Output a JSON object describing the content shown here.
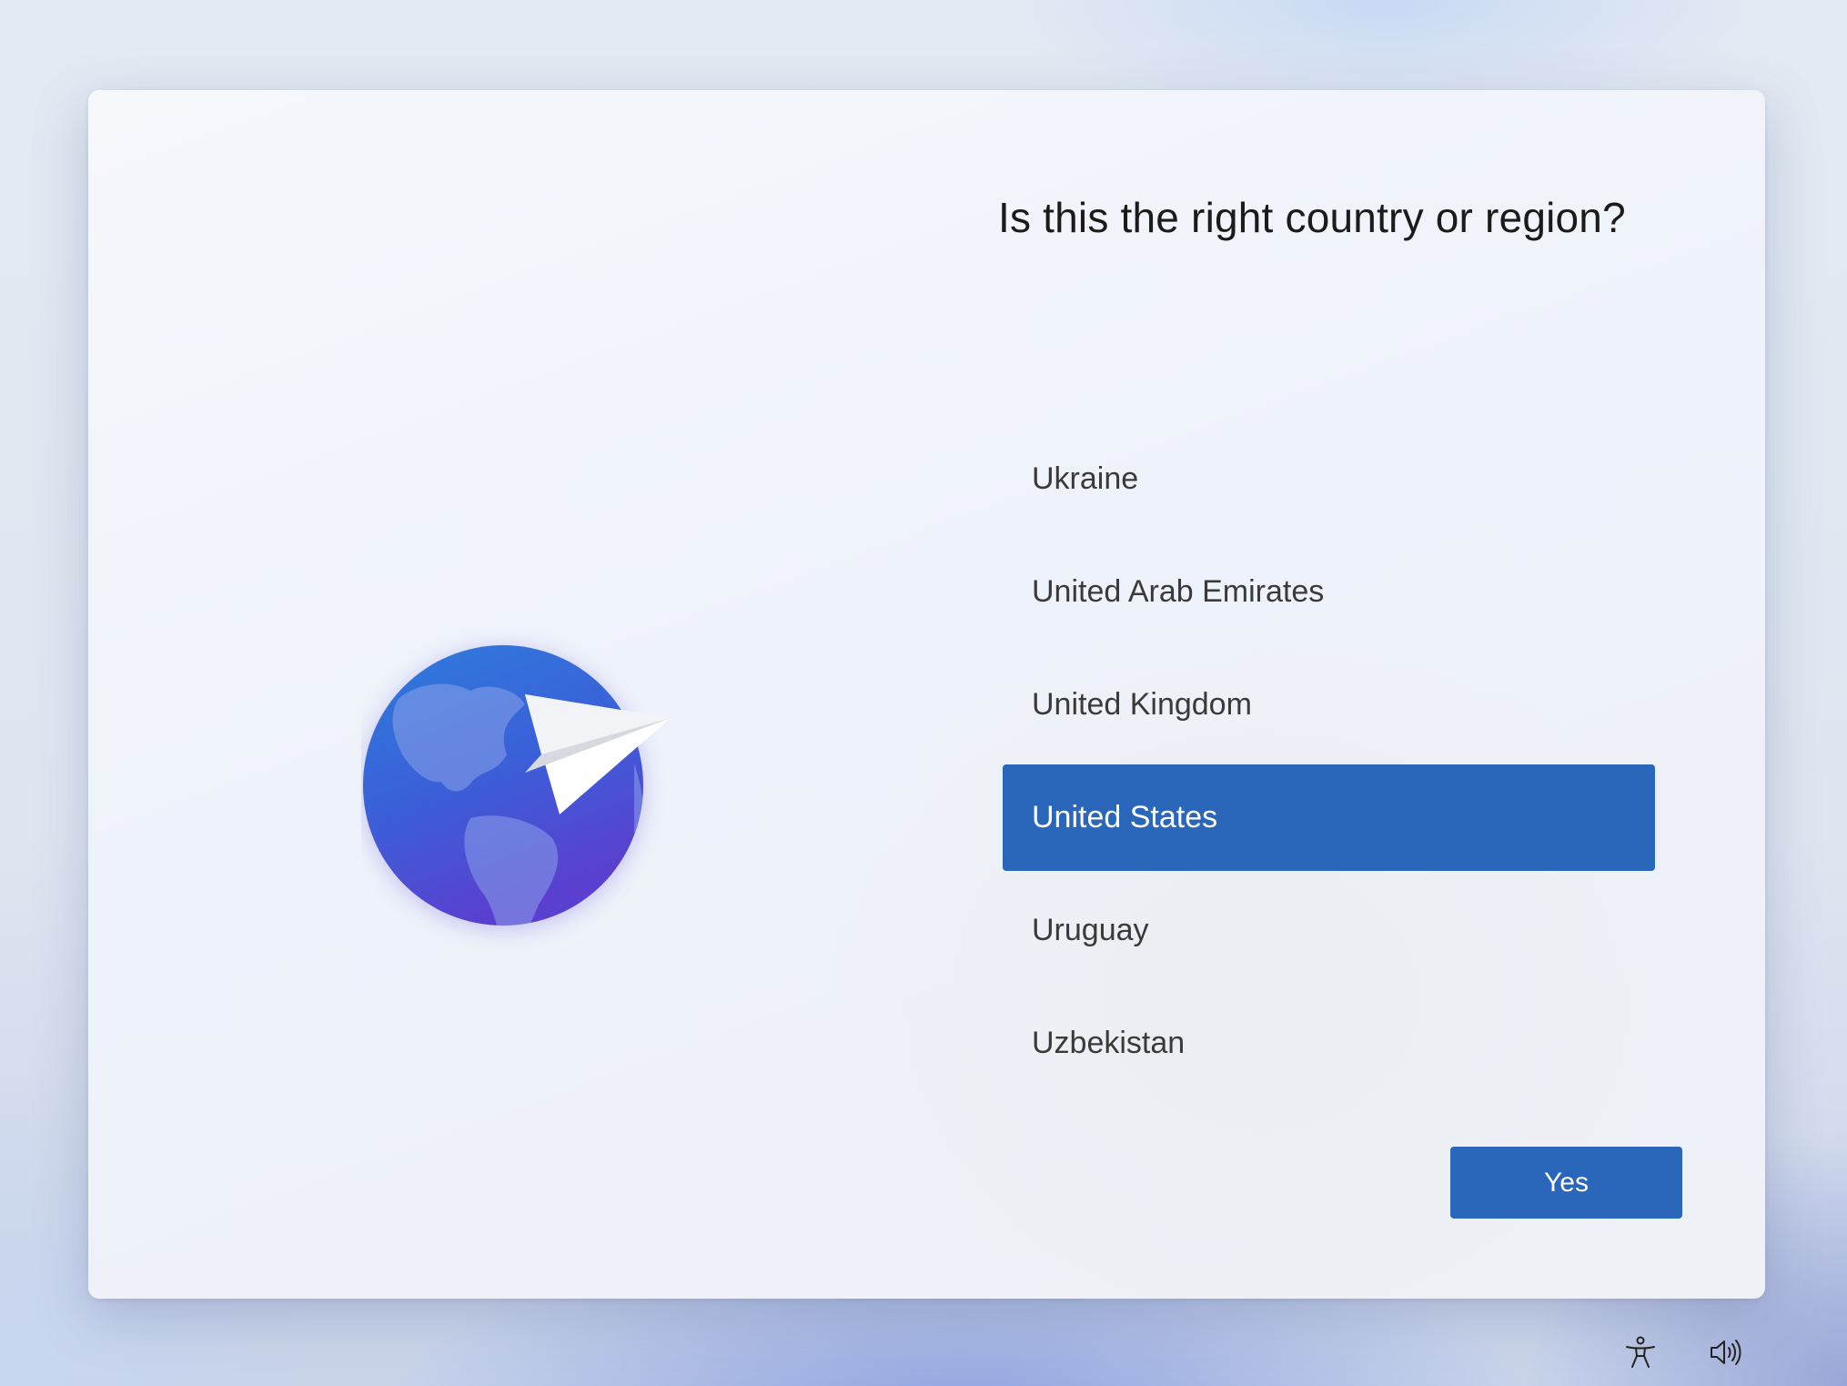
{
  "dialog": {
    "title": "Is this the right country or region?"
  },
  "country_list": {
    "items": [
      {
        "label": "Ukraine",
        "selected": false
      },
      {
        "label": "United Arab Emirates",
        "selected": false
      },
      {
        "label": "United Kingdom",
        "selected": false
      },
      {
        "label": "United States",
        "selected": true
      },
      {
        "label": "Uruguay",
        "selected": false
      },
      {
        "label": "Uzbekistan",
        "selected": false
      }
    ]
  },
  "actions": {
    "yes_label": "Yes"
  },
  "tray": {
    "icons": [
      "accessibility-icon",
      "volume-icon"
    ]
  },
  "colors": {
    "accent": "#2a66b9",
    "globe_top": "#2f7fd9",
    "globe_bottom": "#5a3fd0"
  }
}
